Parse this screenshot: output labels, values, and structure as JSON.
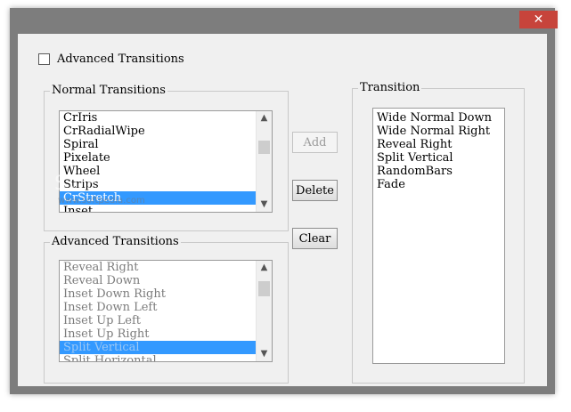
{
  "window": {
    "close_glyph": "✕"
  },
  "advanced_checkbox": {
    "label": "Advanced Transitions",
    "checked": false
  },
  "normal_group": {
    "title": "Normal Transitions",
    "items": [
      "CrIris",
      "CrRadialWipe",
      "Spiral",
      "Pixelate",
      "Wheel",
      "Strips",
      "CrStretch",
      "Inset"
    ],
    "selected": "CrStretch"
  },
  "advanced_group": {
    "title": "Advanced Transitions",
    "items": [
      "Reveal Right",
      "Reveal Down",
      "Inset Down Right",
      "Inset Down Left",
      "Inset Up Left",
      "Inset Up Right",
      "Split Vertical",
      "Split Horizontal"
    ],
    "selected": "Split Vertical"
  },
  "transition_group": {
    "title": "Transition",
    "items": [
      "Wide Normal Down",
      "Wide Normal Right",
      "Reveal Right",
      "Split Vertical",
      "RandomBars",
      "Fade"
    ]
  },
  "buttons": {
    "add": "Add",
    "delete": "Delete",
    "clear": "Clear"
  },
  "watermark": {
    "brand": "SOFTPEDIA",
    "url": "www.softpedia.com"
  },
  "icons": {
    "scroll_up": "▲",
    "scroll_down": "▼"
  }
}
